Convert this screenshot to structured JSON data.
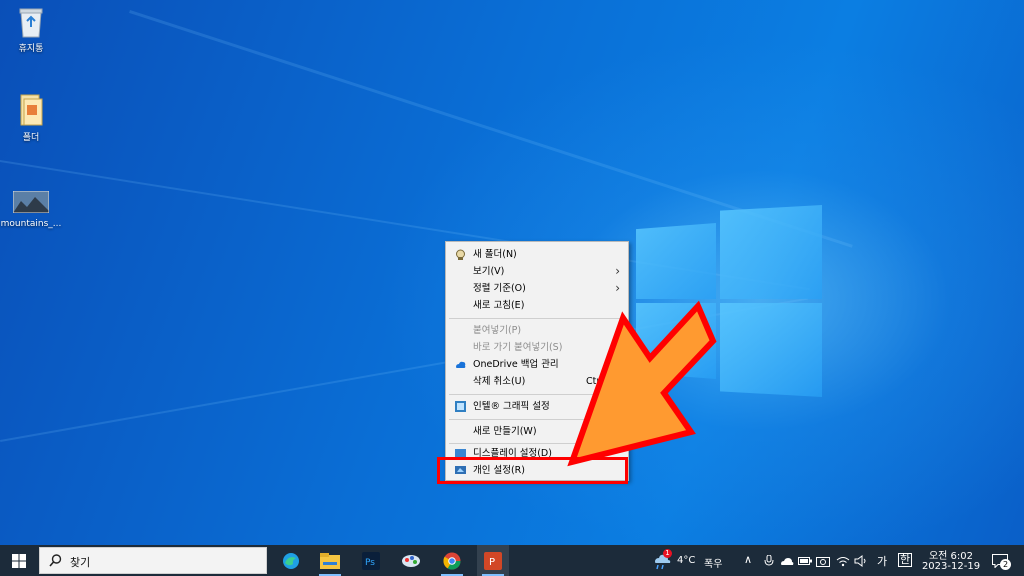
{
  "desktop": {
    "icons": [
      {
        "label": "휴지통",
        "icon": "recycle-bin-icon"
      },
      {
        "label": "폴더",
        "icon": "folder-icon"
      },
      {
        "label": "mountains_...",
        "icon": "image-file-icon"
      }
    ]
  },
  "context_menu": {
    "items": [
      {
        "label": "새 폴더(N)",
        "icon": "folder-icon",
        "enabled": true
      },
      {
        "label": "보기(V)",
        "submenu": true,
        "enabled": true
      },
      {
        "label": "정렬 기준(O)",
        "submenu": true,
        "enabled": true
      },
      {
        "label": "새로 고침(E)",
        "enabled": true
      },
      {
        "label": "붙여넣기(P)",
        "enabled": false
      },
      {
        "label": "바로 가기 붙여넣기(S)",
        "enabled": false
      },
      {
        "label": "OneDrive 백업 관리",
        "icon": "onedrive-cloud-icon",
        "enabled": true
      },
      {
        "label": "삭제 취소(U)",
        "shortcut": "Ctrl",
        "enabled": true
      },
      {
        "label": "인텔® 그래픽 설정",
        "icon": "intel-graphics-icon",
        "enabled": true
      },
      {
        "label": "새로 만들기(W)",
        "enabled": true
      },
      {
        "label": "디스플레이 설정(D)",
        "icon": "display-settings-icon",
        "enabled": true
      },
      {
        "label": "개인 설정(R)",
        "icon": "personalize-icon",
        "enabled": true,
        "highlighted": true
      }
    ]
  },
  "taskbar": {
    "search_label": "찾기",
    "pinned": [
      "edge-icon",
      "file-explorer-icon",
      "photoshop-icon",
      "paint-app-icon",
      "chrome-icon",
      "powerpoint-icon"
    ],
    "weather": {
      "temp": "4°C",
      "condition": "폭우",
      "badge": "1"
    },
    "ime_label": "가",
    "ime_mode": "한",
    "clock": {
      "time": "오전 6:02",
      "date": "2023-12-19"
    },
    "notification_count": "2"
  },
  "colors": {
    "accent_red": "#ff0000",
    "arrow_orange": "#ff9a30",
    "taskbar": "#1c2b3a"
  }
}
